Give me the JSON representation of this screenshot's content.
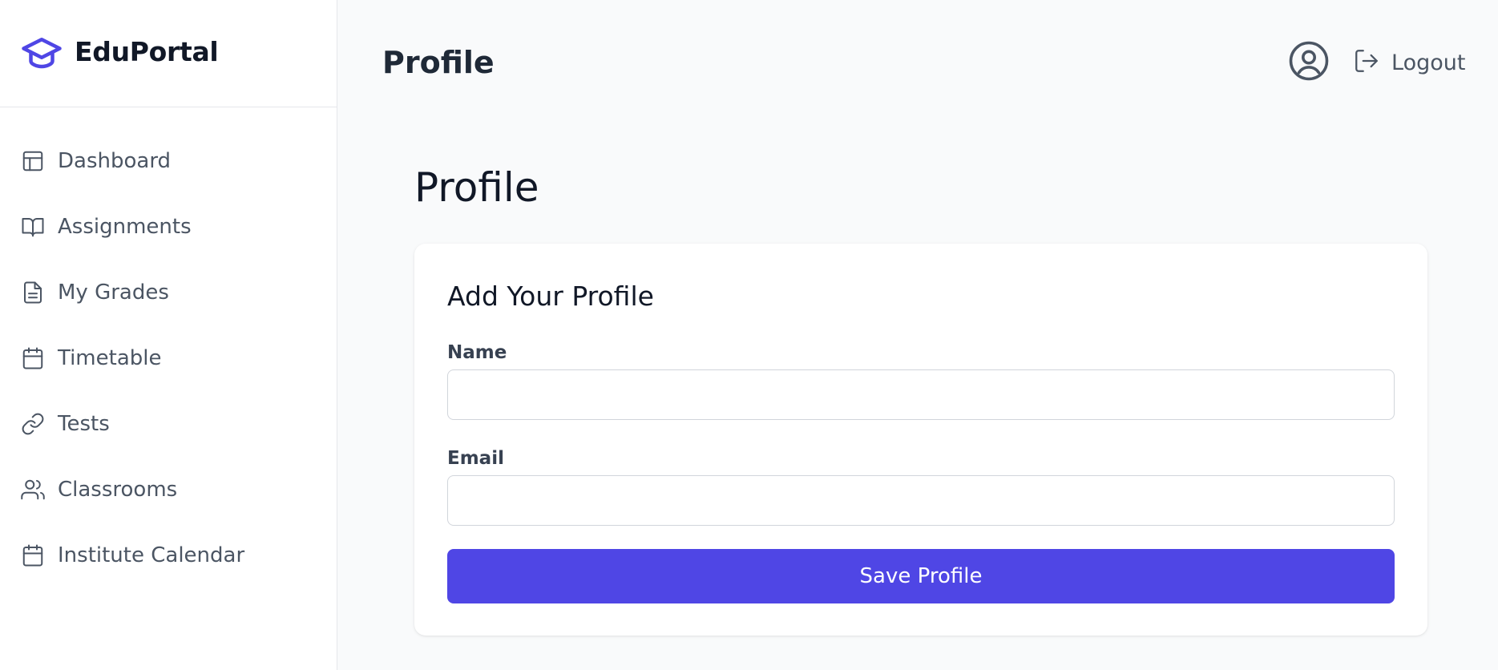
{
  "app": {
    "brand": "EduPortal",
    "brand_icon": "graduation-cap-icon",
    "accent_color": "#4f46e5"
  },
  "sidebar": {
    "items": [
      {
        "label": "Dashboard",
        "icon": "layout-icon"
      },
      {
        "label": "Assignments",
        "icon": "book-open-icon"
      },
      {
        "label": "My Grades",
        "icon": "file-text-icon"
      },
      {
        "label": "Timetable",
        "icon": "calendar-icon"
      },
      {
        "label": "Tests",
        "icon": "link-icon"
      },
      {
        "label": "Classrooms",
        "icon": "users-icon"
      },
      {
        "label": "Institute Calendar",
        "icon": "calendar-icon"
      }
    ]
  },
  "header": {
    "title": "Profile",
    "avatar_icon": "user-circle-icon",
    "logout_label": "Logout",
    "logout_icon": "log-out-icon"
  },
  "main": {
    "title": "Profile",
    "card": {
      "title": "Add Your Profile",
      "name_label": "Name",
      "name_value": "",
      "email_label": "Email",
      "email_value": "",
      "save_label": "Save Profile"
    }
  }
}
